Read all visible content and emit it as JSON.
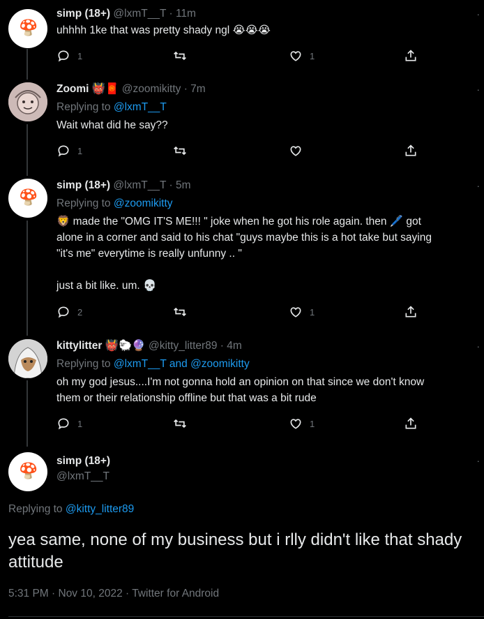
{
  "tweets": [
    {
      "name": "simp (18+)",
      "handle": "@lxmT__T",
      "time": "· 11m",
      "text": "uhhhh 1ke that was pretty shady ngl 😭😭😭",
      "replies": "1",
      "likes": "1"
    },
    {
      "name": "Zoomi",
      "badges": "👹🧧",
      "handle": "@zoomikitty",
      "time": "· 7m",
      "replying_label": "Replying to",
      "replying_to": "@lxmT__T",
      "text": "Wait what did he say??",
      "replies": "1",
      "likes": ""
    },
    {
      "name": "simp (18+)",
      "handle": "@lxmT__T",
      "time": "· 5m",
      "replying_label": "Replying to",
      "replying_to": "@zoomikitty",
      "text": "🦁 made the \"OMG IT'S ME!!! \" joke when he got his role again. then 🖊️ got\nalone in a corner and said to his chat \"guys maybe this is a hot take but saying\n\"it's me\" everytime is really unfunny .. \"\n\njust a bit like. um. 💀",
      "replies": "2",
      "likes": "1"
    },
    {
      "name": "kittylitter",
      "badges": "👹🐑🔮",
      "handle": "@kitty_litter89",
      "time": "· 4m",
      "replying_label": "Replying to",
      "replying_to": "@lxmT__T and @zoomikitty",
      "text": "oh my god jesus....I'm not gonna hold an opinion on that since we don't know\nthem or their relationship offline but that was a bit rude",
      "replies": "1",
      "likes": "1"
    }
  ],
  "main_tweet": {
    "name": "simp (18+)",
    "handle": "@lxmT__T",
    "replying_label": "Replying to",
    "replying_to": "@kitty_litter89",
    "text": "yea same, none of my business but i rlly didn't like that shady attitude",
    "meta": "5:31 PM · Nov 10, 2022 · Twitter for Android"
  },
  "colors": {
    "background": "#000000",
    "text": "#e7e9ea",
    "muted": "#71767b",
    "link": "#1d9bf0"
  },
  "icons": [
    "reply-icon",
    "retweet-icon",
    "like-icon",
    "share-icon",
    "more-icon",
    "mushroom-avatar-icon"
  ]
}
